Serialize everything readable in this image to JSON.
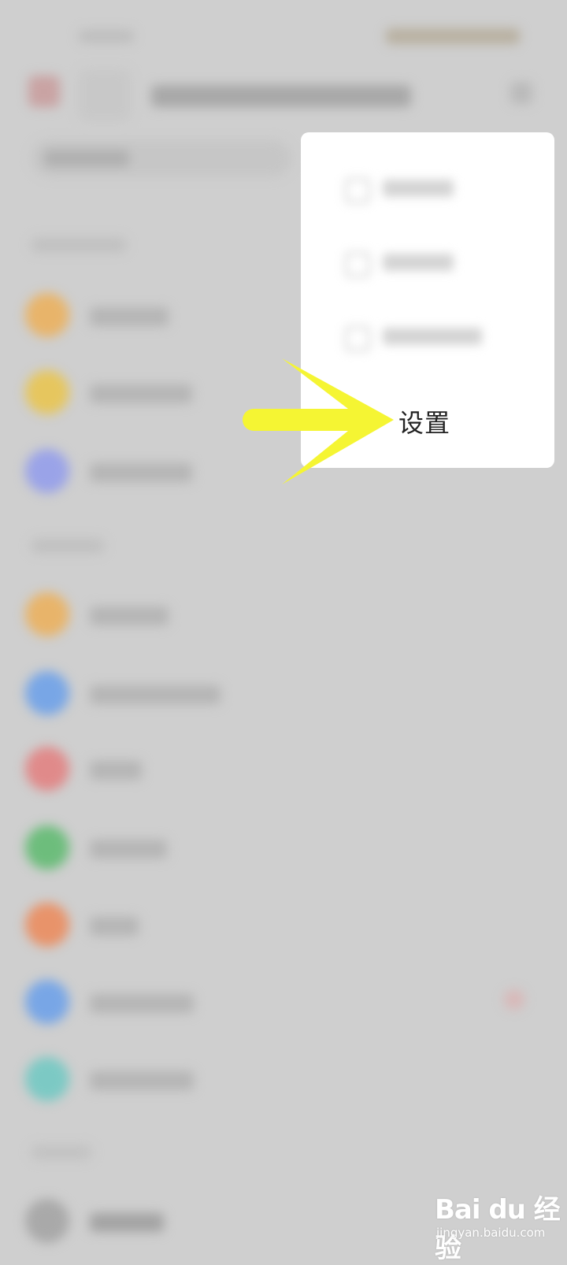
{
  "menu": {
    "settings_label": "设置"
  },
  "watermark": {
    "brand": "Bai du 经验",
    "url": "jingyan.baidu.com"
  },
  "colors": {
    "arrow": "#f5f533",
    "overlay": "#cfcfcf",
    "menu_bg": "#ffffff",
    "icon_orange": "#e8b46a",
    "icon_yellow": "#e6c65e",
    "icon_purple": "#9aa3e8",
    "icon_blue": "#78a6e6",
    "icon_red": "#e08a8a",
    "icon_green": "#6dbd7c",
    "icon_coral": "#e8936a",
    "icon_teal": "#7cc9c4"
  },
  "icons": [
    "arrow-pointer",
    "menu-item-icon",
    "list-item-icon"
  ]
}
